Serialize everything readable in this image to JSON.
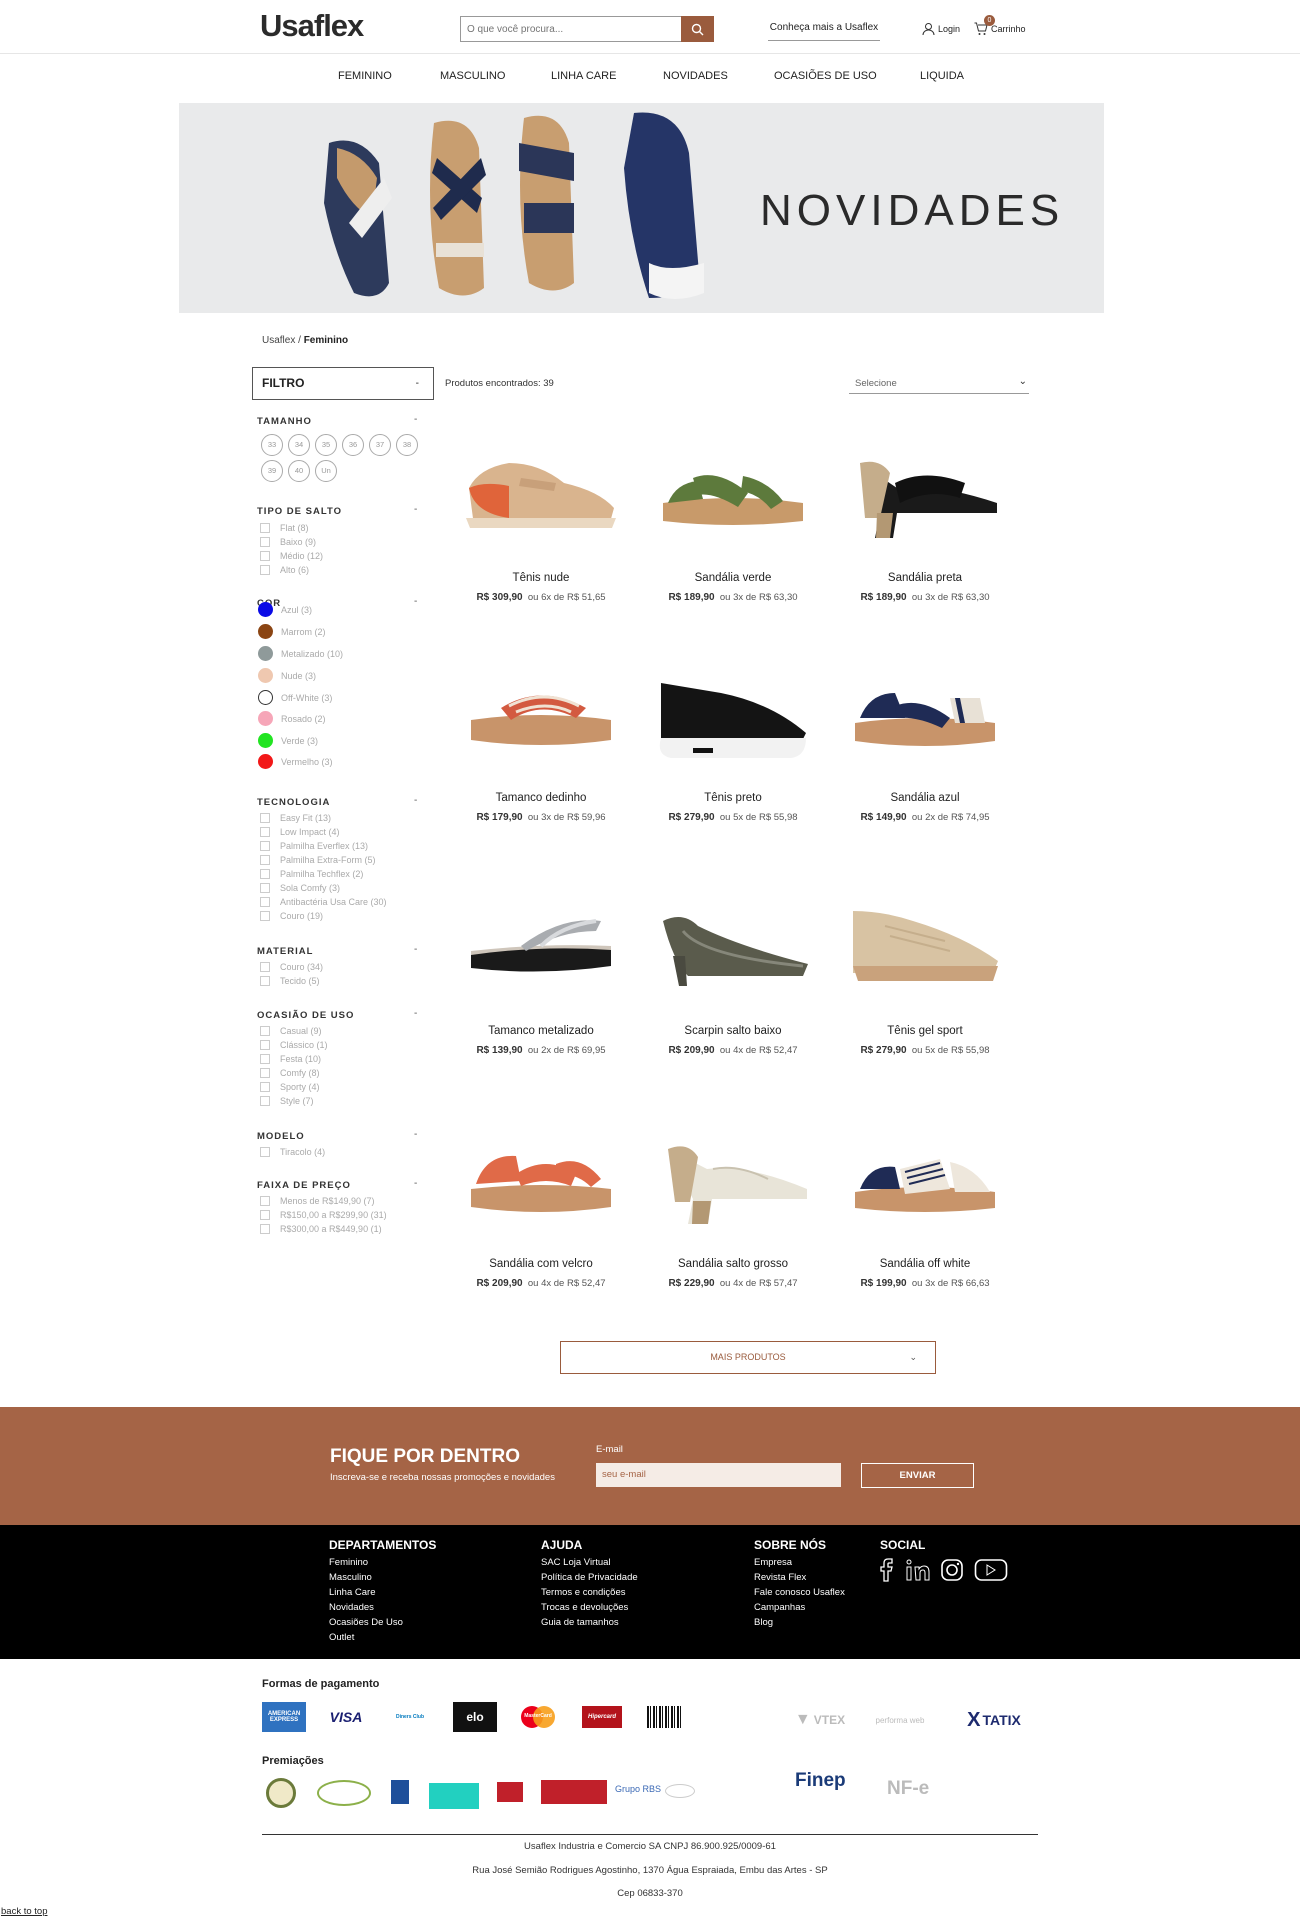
{
  "header": {
    "logo": "Usaflex",
    "search_placeholder": "O que você procura...",
    "about_link": "Conheça mais a Usaflex",
    "login_label": "Login",
    "cart_label": "Carrinho",
    "cart_count": "0"
  },
  "nav": [
    "FEMININO",
    "MASCULINO",
    "LINHA CARE",
    "NOVIDADES",
    "OCASIÕES DE USO",
    "LIQUIDA"
  ],
  "banner": {
    "title": "NOVIDADES"
  },
  "breadcrumb": {
    "home": "Usaflex",
    "sep": "/",
    "current": "Feminino"
  },
  "filter": {
    "title": "FILTRO",
    "toggle": "-",
    "sections": {
      "tamanho": {
        "title": "TAMANHO",
        "sizes": [
          "33",
          "34",
          "35",
          "36",
          "37",
          "38",
          "39",
          "40",
          "Un"
        ]
      },
      "salto": {
        "title": "TIPO DE SALTO",
        "options": [
          "Flat (8)",
          "Baixo (9)",
          "Médio (12)",
          "Alto (6)"
        ]
      },
      "cor": {
        "title": "COR",
        "options": [
          {
            "label": "Azul (3)",
            "color": "#0a0ae6"
          },
          {
            "label": "Marrom (2)",
            "color": "#8b4513"
          },
          {
            "label": "Metalizado (10)",
            "color": "#8f9a9a"
          },
          {
            "label": "Nude (3)",
            "color": "#efc8b0"
          },
          {
            "label": "Off-White (3)",
            "color": "#ffffff"
          },
          {
            "label": "Rosado (2)",
            "color": "#f6a6b8"
          },
          {
            "label": "Verde (3)",
            "color": "#22e422"
          },
          {
            "label": "Vermelho (3)",
            "color": "#f21818"
          }
        ]
      },
      "tecnologia": {
        "title": "TECNOLOGIA",
        "options": [
          "Easy Fit (13)",
          "Low Impact (4)",
          "Palmilha Everflex (13)",
          "Palmilha Extra-Form (5)",
          "Palmilha Techflex (2)",
          "Sola Comfy (3)",
          "Antibactéria Usa Care (30)",
          "Couro (19)"
        ]
      },
      "material": {
        "title": "MATERIAL",
        "options": [
          "Couro (34)",
          "Tecido (5)"
        ]
      },
      "ocasiao": {
        "title": "OCASIÃO DE USO",
        "options": [
          "Casual (9)",
          "Clássico (1)",
          "Festa (10)",
          "Comfy (8)",
          "Sporty (4)",
          "Style (7)"
        ]
      },
      "modelo": {
        "title": "MODELO",
        "options": [
          "Tiracolo (4)"
        ]
      },
      "preco": {
        "title": "FAIXA DE PREÇO",
        "options": [
          "Menos de R$149,90 (7)",
          "R$150,00 a R$299,90 (31)",
          "R$300,00 a R$449,90 (1)"
        ]
      }
    }
  },
  "results": {
    "count_label": "Produtos encontrados: 39",
    "sort_label": "Selecione"
  },
  "products": [
    {
      "name": "Tênis nude",
      "price": "R$ 309,90",
      "installments": "ou 6x de R$ 51,65",
      "icon": "sneaker-nude"
    },
    {
      "name": "Sandália verde",
      "price": "R$ 189,90",
      "installments": "ou 3x de R$ 63,30",
      "icon": "sandal-green"
    },
    {
      "name": "Sandália preta",
      "price": "R$ 189,90",
      "installments": "ou 3x de R$ 63,30",
      "icon": "sandal-black-heel"
    },
    {
      "name": "Tamanco dedinho",
      "price": "R$ 179,90",
      "installments": "ou 3x de R$ 59,96",
      "icon": "clog-striped"
    },
    {
      "name": "Tênis preto",
      "price": "R$ 279,90",
      "installments": "ou 5x de R$ 55,98",
      "icon": "sneaker-black"
    },
    {
      "name": "Sandália azul",
      "price": "R$ 149,90",
      "installments": "ou 2x de R$ 74,95",
      "icon": "sandal-blue"
    },
    {
      "name": "Tamanco metalizado",
      "price": "R$ 139,90",
      "installments": "ou 2x de R$ 69,95",
      "icon": "clog-metallic"
    },
    {
      "name": "Scarpin salto baixo",
      "price": "R$ 209,90",
      "installments": "ou 4x de R$ 52,47",
      "icon": "pump-metallic"
    },
    {
      "name": "Tênis gel sport",
      "price": "R$ 279,90",
      "installments": "ou 5x de R$ 55,98",
      "icon": "sneaker-beige"
    },
    {
      "name": "Sandália com velcro",
      "price": "R$ 209,90",
      "installments": "ou 4x de R$ 52,47",
      "icon": "sandal-orange"
    },
    {
      "name": "Sandália salto grosso",
      "price": "R$ 229,90",
      "installments": "ou 4x de R$ 57,47",
      "icon": "sandal-white-heel"
    },
    {
      "name": "Sandália off white",
      "price": "R$ 199,90",
      "installments": "ou 3x de R$ 66,63",
      "icon": "sandal-offwhite"
    }
  ],
  "more_button": "MAIS PRODUTOS",
  "newsletter": {
    "title": "FIQUE POR DENTRO",
    "subtitle": "Inscreva-se e receba nossas promoções e novidades",
    "email_label": "E-mail",
    "email_placeholder": "seu e-mail",
    "submit": "ENVIAR"
  },
  "footer": {
    "departamentos": {
      "title": "DEPARTAMENTOS",
      "links": [
        "Feminino",
        "Masculino",
        "Linha Care",
        "Novidades",
        "Ocasiões De Uso",
        "Outlet"
      ]
    },
    "ajuda": {
      "title": "AJUDA",
      "links": [
        "SAC Loja Virtual",
        "Política de Privacidade",
        "Termos e condições",
        "Trocas e devoluções",
        "Guia de tamanhos"
      ]
    },
    "sobre": {
      "title": "SOBRE NÓS",
      "links": [
        "Empresa",
        "Revista Flex",
        "Fale conosco Usaflex",
        "Campanhas",
        "Blog"
      ]
    },
    "social": {
      "title": "SOCIAL"
    }
  },
  "payments": {
    "title": "Formas de pagamento",
    "methods": [
      "AMERICAN EXPRESS",
      "VISA",
      "Diners Club",
      "elo",
      "MasterCard",
      "Hipercard",
      "boleto"
    ],
    "partners": [
      "VTEX",
      "performa web",
      "TATIX"
    ]
  },
  "awards": {
    "title": "Premiações",
    "finep": "Finep",
    "nfe": "NF-e",
    "rbs": "Grupo RBS"
  },
  "legal": {
    "company": "Usaflex Industria e Comercio SA CNPJ 86.900.925/0009-61",
    "address": "Rua José Semião Rodrigues Agostinho, 1370 Água Espraiada, Embu das Artes - SP",
    "cep": "Cep 06833-370"
  },
  "back_to_top": "back to top",
  "colors": {
    "brand": "#a56446",
    "accent": "#9a5b3d"
  }
}
